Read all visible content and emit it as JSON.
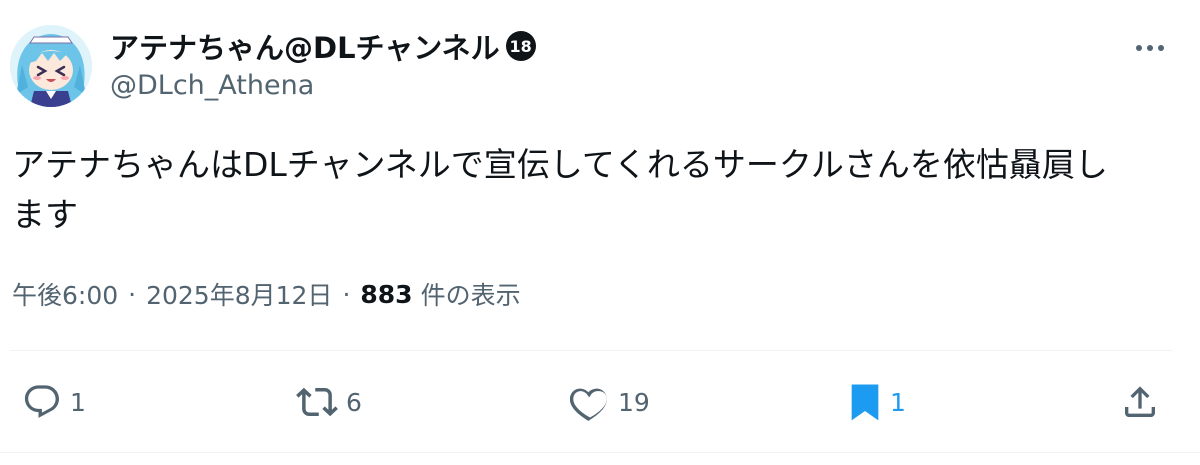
{
  "author": {
    "display_name": "アテナちゃん@DLチャンネル",
    "age_badge": "18",
    "handle": "@DLch_Athena",
    "avatar": "anime-girl-avatar"
  },
  "post": {
    "text_lines": [
      "アテナちゃんはDLチャンネルで宣伝してくれるサークルさんを依怙贔屓し",
      "ます"
    ]
  },
  "meta": {
    "time": "午後6:00",
    "separator": "·",
    "date": "2025年8月12日",
    "views_count": "883",
    "views_label": "件の表示"
  },
  "actions": {
    "reply": {
      "icon": "reply-icon",
      "count": "1"
    },
    "repost": {
      "icon": "repost-icon",
      "count": "6"
    },
    "like": {
      "icon": "heart-icon",
      "count": "19"
    },
    "bookmark": {
      "icon": "bookmark-icon",
      "count": "1",
      "active": true
    },
    "share": {
      "icon": "share-icon"
    }
  },
  "colors": {
    "text_primary": "#0f1419",
    "text_secondary": "#536471",
    "accent": "#1d9bf0",
    "divider": "#eff3f4"
  }
}
